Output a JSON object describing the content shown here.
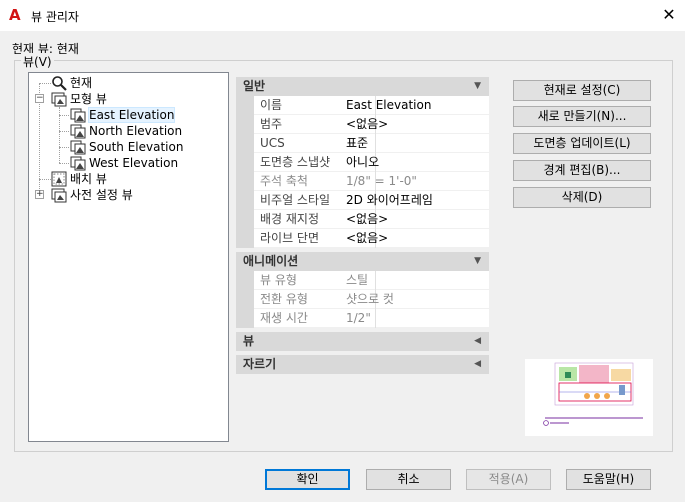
{
  "window": {
    "title": "뷰 관리자",
    "app_icon": "A",
    "close_glyph": "✕"
  },
  "current_view_label": "현재 뷰: 현재",
  "views_group_label": "뷰(V)",
  "tree": {
    "items": [
      {
        "label": "현재",
        "icon": "magnifier-icon"
      },
      {
        "label": "모형 뷰",
        "icon": "model-views-icon"
      },
      {
        "label": "East Elevation",
        "icon": "named-view-icon",
        "selected": true
      },
      {
        "label": "North Elevation",
        "icon": "named-view-icon"
      },
      {
        "label": "South Elevation",
        "icon": "named-view-icon"
      },
      {
        "label": "West Elevation",
        "icon": "named-view-icon"
      },
      {
        "label": "배치 뷰",
        "icon": "layout-views-icon"
      },
      {
        "label": "사전 설정 뷰",
        "icon": "preset-views-icon"
      }
    ]
  },
  "properties": {
    "general": {
      "title": "일반",
      "rows": [
        {
          "name": "이름",
          "value": "East Elevation"
        },
        {
          "name": "범주",
          "value": "<없음>"
        },
        {
          "name": "UCS",
          "value": "표준"
        },
        {
          "name": "도면층 스냅샷",
          "value": "아니오"
        },
        {
          "name": "주석 축척",
          "value": "1/8\" = 1'-0\"",
          "dim": true
        },
        {
          "name": "비주얼 스타일",
          "value": "2D 와이어프레임"
        },
        {
          "name": "배경 재지정",
          "value": "<없음>"
        },
        {
          "name": "라이브 단면",
          "value": "<없음>"
        }
      ]
    },
    "animation": {
      "title": "애니메이션",
      "rows": [
        {
          "name": "뷰 유형",
          "value": "스틸",
          "dim": true
        },
        {
          "name": "전환 유형",
          "value": "샷으로 컷",
          "dim": true
        },
        {
          "name": "재생 시간",
          "value": "1/2\"",
          "dim": true
        }
      ]
    },
    "view": {
      "title": "뷰"
    },
    "clipping": {
      "title": "자르기"
    }
  },
  "buttons": {
    "set_current": "현재로 설정(C)",
    "new": "새로 만들기(N)...",
    "update_layers": "도면층 업데이트(L)",
    "edit_boundaries": "경계 편집(B)...",
    "delete": "삭제(D)",
    "ok": "확인",
    "cancel": "취소",
    "apply": "적용(A)",
    "help": "도움말(H)"
  },
  "colors": {
    "accent": "#0078d7",
    "section_bg": "#d9d9d9",
    "app_icon": "#d21414"
  }
}
